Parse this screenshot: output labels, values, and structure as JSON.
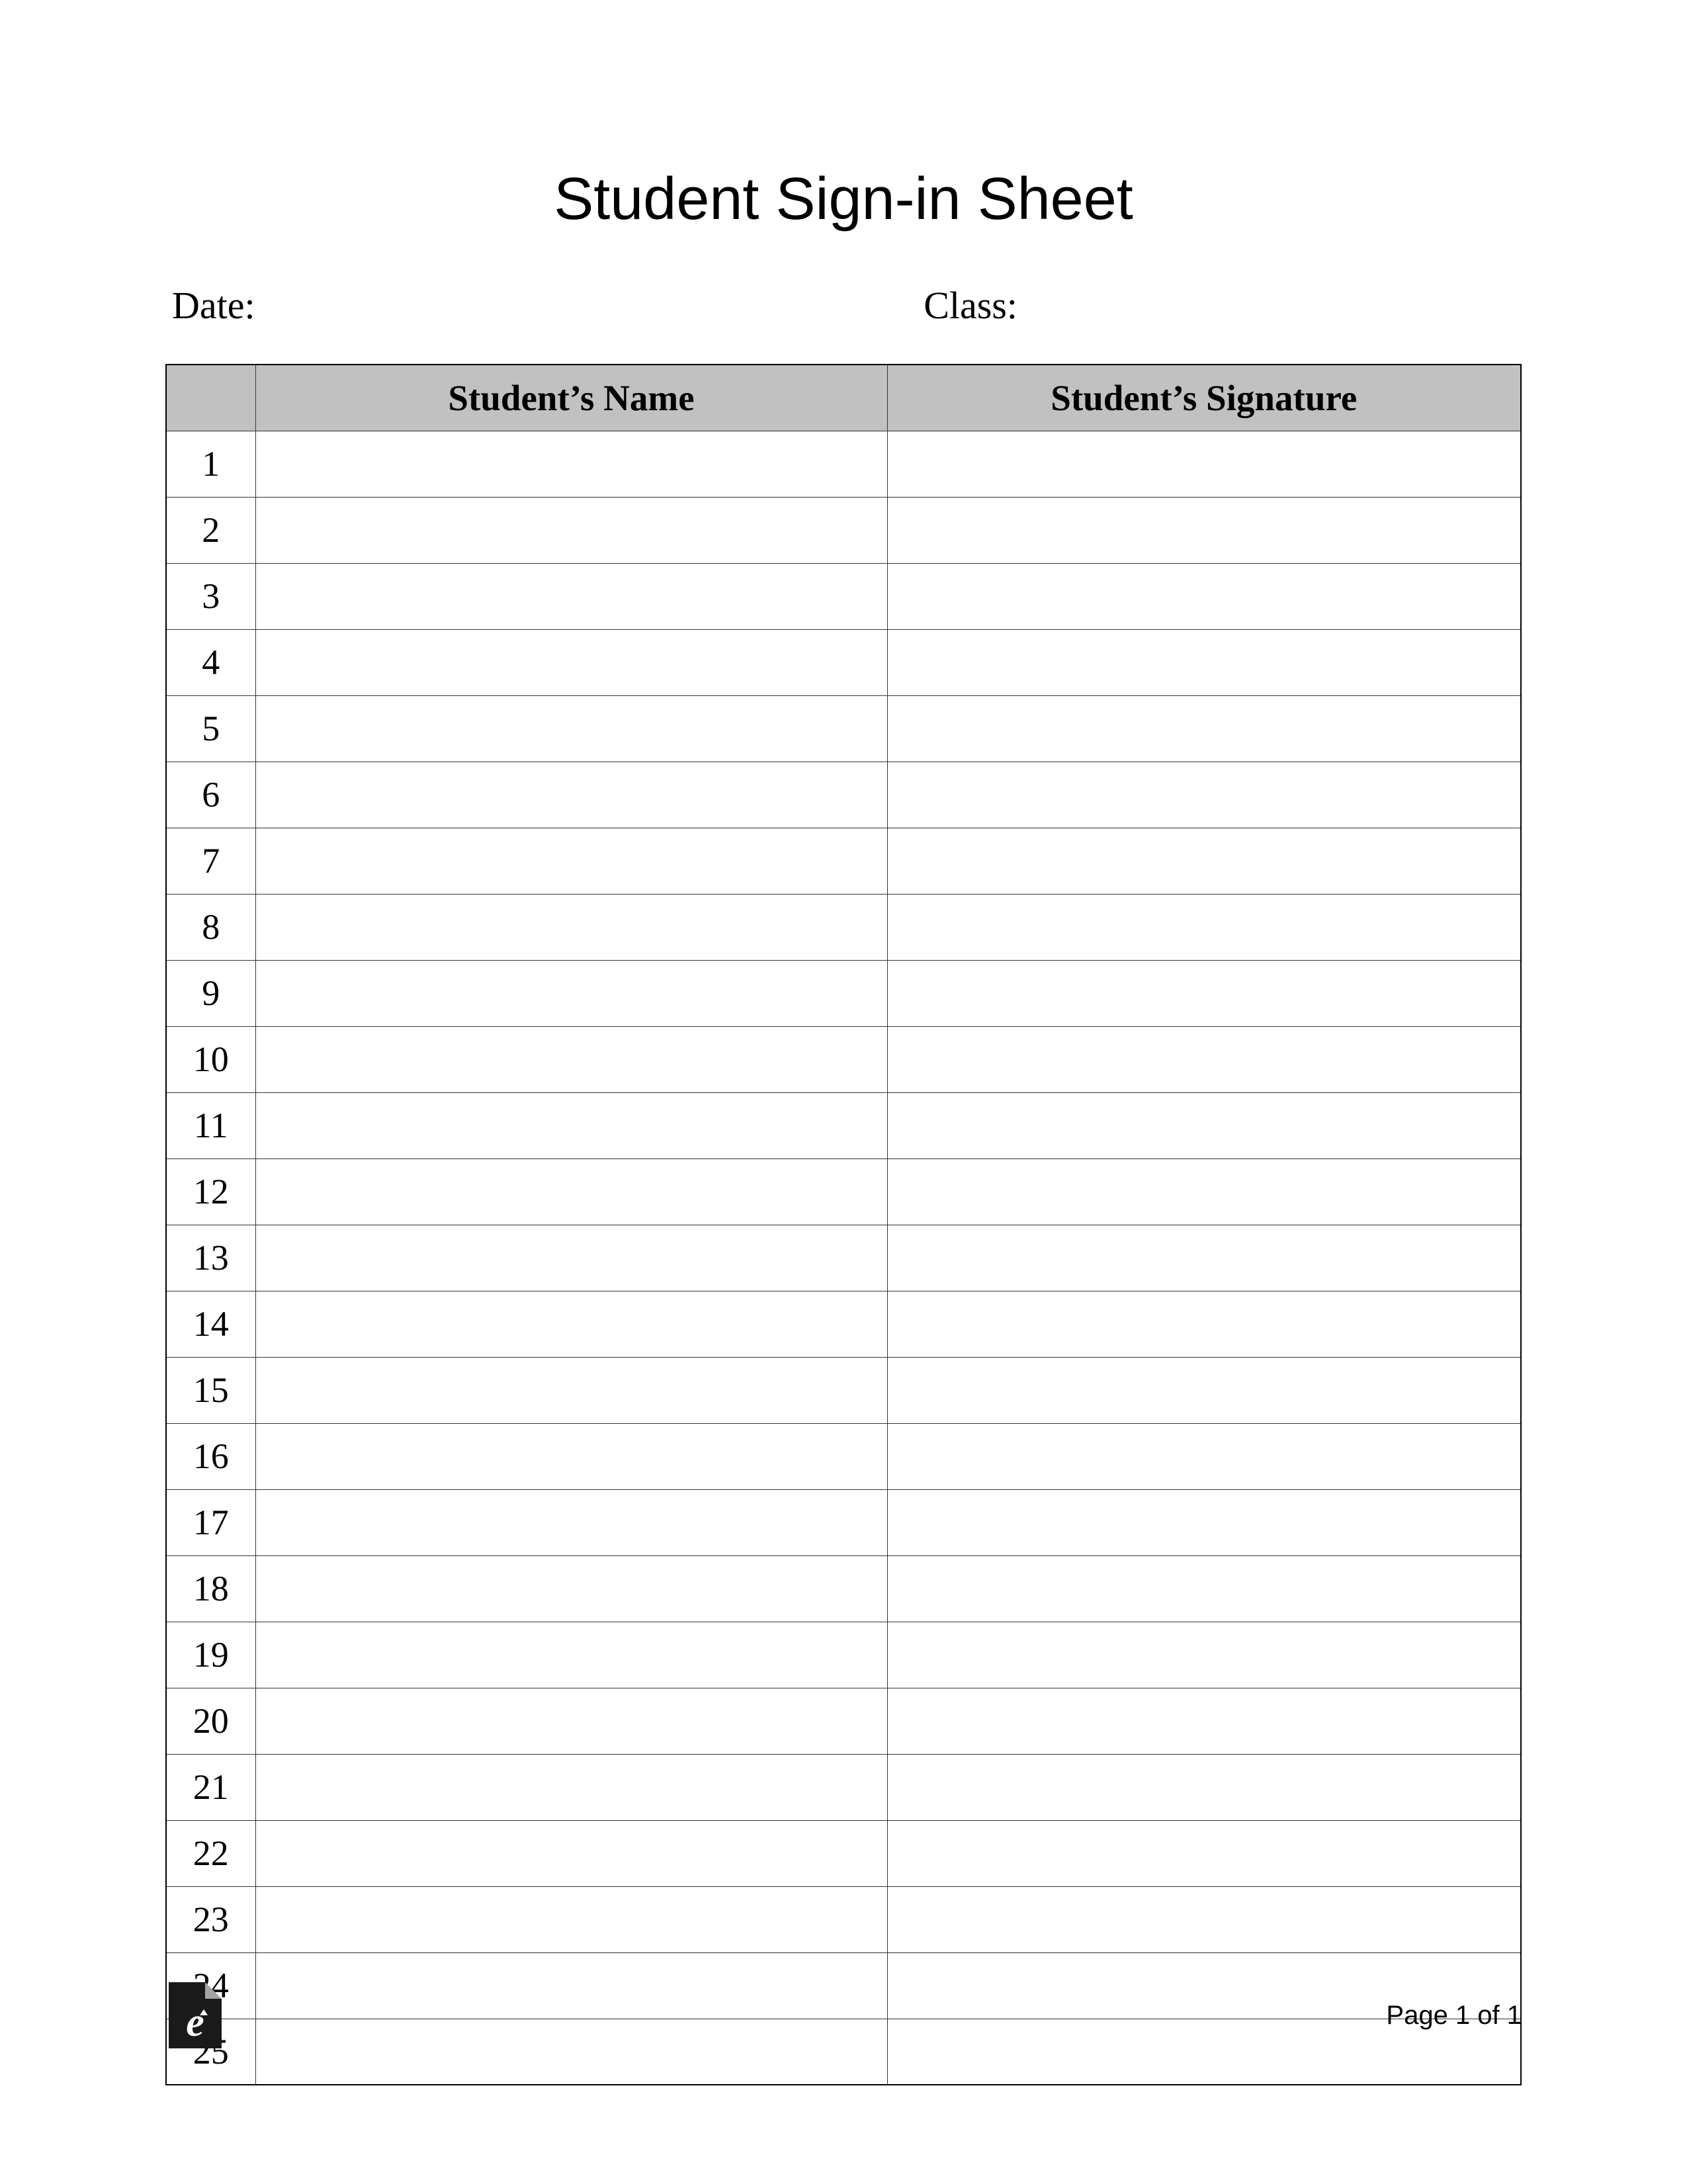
{
  "title": "Student Sign-in Sheet",
  "meta": {
    "date_label": "Date:",
    "class_label": "Class:"
  },
  "table": {
    "headers": {
      "number": "",
      "name": "Student’s Name",
      "signature": "Student’s Signature"
    },
    "rows": [
      {
        "num": "1",
        "name": "",
        "signature": ""
      },
      {
        "num": "2",
        "name": "",
        "signature": ""
      },
      {
        "num": "3",
        "name": "",
        "signature": ""
      },
      {
        "num": "4",
        "name": "",
        "signature": ""
      },
      {
        "num": "5",
        "name": "",
        "signature": ""
      },
      {
        "num": "6",
        "name": "",
        "signature": ""
      },
      {
        "num": "7",
        "name": "",
        "signature": ""
      },
      {
        "num": "8",
        "name": "",
        "signature": ""
      },
      {
        "num": "9",
        "name": "",
        "signature": ""
      },
      {
        "num": "10",
        "name": "",
        "signature": ""
      },
      {
        "num": "11",
        "name": "",
        "signature": ""
      },
      {
        "num": "12",
        "name": "",
        "signature": ""
      },
      {
        "num": "13",
        "name": "",
        "signature": ""
      },
      {
        "num": "14",
        "name": "",
        "signature": ""
      },
      {
        "num": "15",
        "name": "",
        "signature": ""
      },
      {
        "num": "16",
        "name": "",
        "signature": ""
      },
      {
        "num": "17",
        "name": "",
        "signature": ""
      },
      {
        "num": "18",
        "name": "",
        "signature": ""
      },
      {
        "num": "19",
        "name": "",
        "signature": ""
      },
      {
        "num": "20",
        "name": "",
        "signature": ""
      },
      {
        "num": "21",
        "name": "",
        "signature": ""
      },
      {
        "num": "22",
        "name": "",
        "signature": ""
      },
      {
        "num": "23",
        "name": "",
        "signature": ""
      },
      {
        "num": "24",
        "name": "",
        "signature": ""
      },
      {
        "num": "25",
        "name": "",
        "signature": ""
      }
    ]
  },
  "footer": {
    "page_label": "Page 1 of 1"
  }
}
